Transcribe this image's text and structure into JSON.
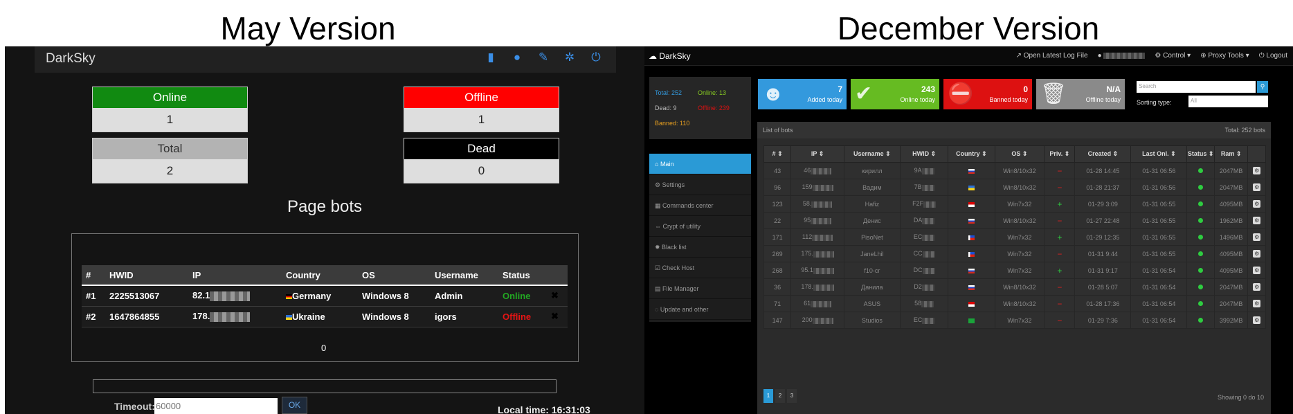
{
  "captions": {
    "left": "May Version",
    "right": "December Version"
  },
  "may": {
    "brand": "DarkSky",
    "nav_icons": [
      "signal-icon",
      "user-icon",
      "pin-icon",
      "gear-icon",
      "power-icon"
    ],
    "stats": {
      "online": {
        "label": "Online",
        "value": "1",
        "color": "#118a11"
      },
      "offline": {
        "label": "Offline",
        "value": "1",
        "color": "#ff0000"
      },
      "total": {
        "label": "Total",
        "value": "2",
        "color": "#b3b3b3"
      },
      "dead": {
        "label": "Dead",
        "value": "0",
        "color": "#000000"
      }
    },
    "page_title": "Page bots",
    "table": {
      "headers": [
        "#",
        "HWID",
        "IP",
        "Country",
        "OS",
        "Username",
        "Status"
      ],
      "rows": [
        {
          "num": "#1",
          "hwid": "2225513067",
          "ip": "82.1",
          "country": "Germany",
          "os": "Windows 8",
          "username": "Admin",
          "status": "Online",
          "status_color": "#22a822"
        },
        {
          "num": "#2",
          "hwid": "1647864855",
          "ip": "178.",
          "country": "Ukraine",
          "os": "Windows 8",
          "username": "igors",
          "status": "Offline",
          "status_color": "#e81414"
        }
      ]
    },
    "page_number": "0",
    "timeout_label": "Timeout:",
    "timeout_placeholder": "60000",
    "ok_label": "OK",
    "local_time": "Local time: 16:31:03"
  },
  "dec": {
    "brand": "DarkSky",
    "top_links": [
      "Open Latest Log File",
      "Control ▾",
      "Proxy Tools ▾",
      "Logout"
    ],
    "stats": {
      "total": "Total: 252",
      "online": "Online: 13",
      "dead": "Dead: 9",
      "offline": "Offline: 239",
      "banned": "Banned: 110"
    },
    "menu": [
      "Main",
      "Settings",
      "Commands center",
      "Crypt of utility",
      "Black list",
      "Check Host",
      "File Manager",
      "Update and other"
    ],
    "tiles": [
      {
        "num": "7",
        "label": "Added today",
        "color": "#3399dd",
        "icon": "user-icon"
      },
      {
        "num": "243",
        "label": "Online today",
        "color": "#66bb22",
        "icon": "check-icon"
      },
      {
        "num": "0",
        "label": "Banned today",
        "color": "#dd1111",
        "icon": "ban-icon"
      },
      {
        "num": "N/A",
        "label": "Offline today",
        "color": "#8a8a8a",
        "icon": "trash-icon"
      }
    ],
    "search_placeholder": "Search",
    "sorting_label": "Sorting type:",
    "sorting_value": "All",
    "panel_title": "List of bots",
    "panel_total": "Total: 252 bots",
    "headers": [
      "#",
      "IP",
      "Username",
      "HWID",
      "Country",
      "OS",
      "Priv.",
      "Created",
      "Last Onl.",
      "Status",
      "Ram",
      ""
    ],
    "rows": [
      {
        "n": "43",
        "ip": "46",
        "user": "кирилл",
        "hwid": "9A",
        "flag": "ru",
        "os": "Win8/10x32",
        "priv": "−",
        "created": "01-28 14:45",
        "last": "01-31 06:56",
        "ram": "2047MB"
      },
      {
        "n": "96",
        "ip": "159",
        "user": "Вадим",
        "hwid": "7B",
        "flag": "ua",
        "os": "Win8/10x32",
        "priv": "−",
        "created": "01-28 21:37",
        "last": "01-31 06:56",
        "ram": "2047MB"
      },
      {
        "n": "123",
        "ip": "58.",
        "user": "Hafiz",
        "hwid": "F2F",
        "flag": "id",
        "os": "Win7x32",
        "priv": "+",
        "created": "01-29 3:09",
        "last": "01-31 06:55",
        "ram": "4095MB"
      },
      {
        "n": "22",
        "ip": "95",
        "user": "Денис",
        "hwid": "DA",
        "flag": "ru",
        "os": "Win8/10x32",
        "priv": "−",
        "created": "01-27 22:48",
        "last": "01-31 06:55",
        "ram": "1962MB"
      },
      {
        "n": "171",
        "ip": "112",
        "user": "PisoNet",
        "hwid": "EC",
        "flag": "ph",
        "os": "Win7x32",
        "priv": "+",
        "created": "01-29 12:35",
        "last": "01-31 06:55",
        "ram": "1496MB"
      },
      {
        "n": "269",
        "ip": "175.",
        "user": "JaneLhil",
        "hwid": "CC",
        "flag": "ph",
        "os": "Win7x32",
        "priv": "−",
        "created": "01-31 9:44",
        "last": "01-31 06:55",
        "ram": "4095MB"
      },
      {
        "n": "268",
        "ip": "95.1",
        "user": "f10-cr",
        "hwid": "DC",
        "flag": "ru",
        "os": "Win7x32",
        "priv": "+",
        "created": "01-31 9:17",
        "last": "01-31 06:54",
        "ram": "4095MB"
      },
      {
        "n": "36",
        "ip": "178.",
        "user": "Данила",
        "hwid": "D2",
        "flag": "ru",
        "os": "Win8/10x32",
        "priv": "−",
        "created": "01-28 5:07",
        "last": "01-31 06:54",
        "ram": "2047MB"
      },
      {
        "n": "71",
        "ip": "61",
        "user": "ASUS",
        "hwid": "58",
        "flag": "id",
        "os": "Win8/10x32",
        "priv": "−",
        "created": "01-28 17:36",
        "last": "01-31 06:54",
        "ram": "2047MB"
      },
      {
        "n": "147",
        "ip": "200",
        "user": "Studios",
        "hwid": "EC",
        "flag": "br",
        "os": "Win7x32",
        "priv": "−",
        "created": "01-29 7:36",
        "last": "01-31 06:54",
        "ram": "3992MB"
      }
    ],
    "pages": [
      "1",
      "2",
      "3"
    ],
    "showing": "Showing 0 do 10"
  }
}
